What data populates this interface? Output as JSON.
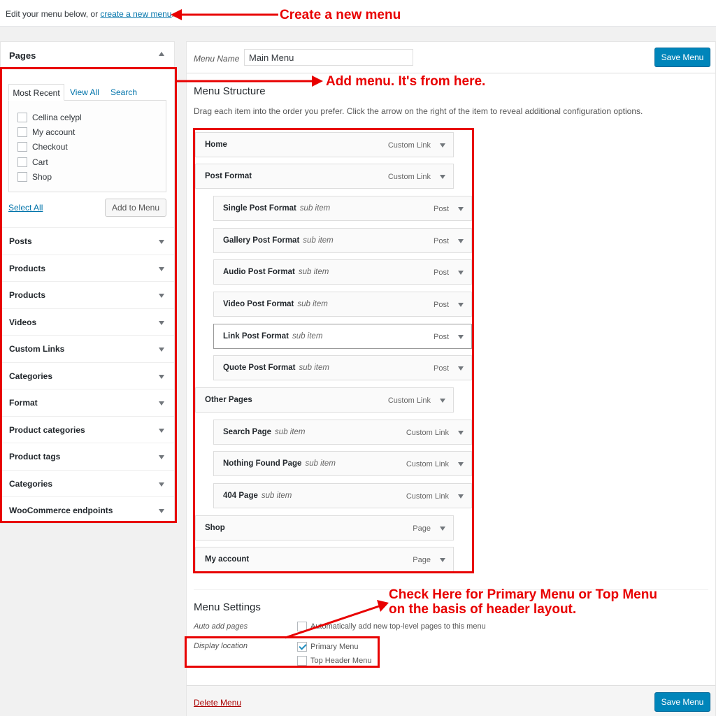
{
  "topbar": {
    "intro_text": "Edit your menu below, or",
    "create_link": "create a new menu",
    "trailing": "."
  },
  "left_panel": {
    "pages_title": "Pages",
    "tabs": [
      {
        "label": "Most Recent"
      },
      {
        "label": "View All"
      },
      {
        "label": "Search"
      }
    ],
    "pages": [
      {
        "label": "Cellina celypl"
      },
      {
        "label": "My account"
      },
      {
        "label": "Checkout"
      },
      {
        "label": "Cart"
      },
      {
        "label": "Shop"
      }
    ],
    "select_all": "Select All",
    "add_to_menu": "Add to Menu",
    "accordion": [
      {
        "label": "Posts"
      },
      {
        "label": "Products"
      },
      {
        "label": "Products"
      },
      {
        "label": "Videos"
      },
      {
        "label": "Custom Links"
      },
      {
        "label": "Categories"
      },
      {
        "label": "Format"
      },
      {
        "label": "Product categories"
      },
      {
        "label": "Product tags"
      },
      {
        "label": "Categories"
      },
      {
        "label": "WooCommerce endpoints"
      }
    ]
  },
  "menu": {
    "name_label": "Menu Name",
    "name_value": "Main Menu",
    "save_label": "Save Menu",
    "structure_title": "Menu Structure",
    "structure_desc": "Drag each item into the order you prefer. Click the arrow on the right of the item to reveal additional configuration options.",
    "items": [
      {
        "title": "Home",
        "sub": "",
        "type": "Custom Link"
      },
      {
        "title": "Post Format",
        "sub": "",
        "type": "Custom Link"
      },
      {
        "title": "Single Post Format",
        "sub": "sub item",
        "type": "Post"
      },
      {
        "title": "Gallery Post Format",
        "sub": "sub item",
        "type": "Post"
      },
      {
        "title": "Audio Post Format",
        "sub": "sub item",
        "type": "Post"
      },
      {
        "title": "Video Post Format",
        "sub": "sub item",
        "type": "Post"
      },
      {
        "title": "Link Post Format",
        "sub": "sub item",
        "type": "Post"
      },
      {
        "title": "Quote Post Format",
        "sub": "sub item",
        "type": "Post"
      },
      {
        "title": "Other Pages",
        "sub": "",
        "type": "Custom Link"
      },
      {
        "title": "Search Page",
        "sub": "sub item",
        "type": "Custom Link"
      },
      {
        "title": "Nothing Found Page",
        "sub": "sub item",
        "type": "Custom Link"
      },
      {
        "title": "404 Page",
        "sub": "sub item",
        "type": "Custom Link"
      },
      {
        "title": "Shop",
        "sub": "",
        "type": "Page"
      },
      {
        "title": "My account",
        "sub": "",
        "type": "Page"
      }
    ],
    "settings_title": "Menu Settings",
    "auto_add_label": "Auto add pages",
    "auto_add_text": "Automatically add new top-level pages to this menu",
    "display_location_label": "Display location",
    "locations": [
      {
        "label": "Primary Menu",
        "checked": true
      },
      {
        "label": "Top Header Menu",
        "checked": false
      }
    ],
    "delete_label": "Delete Menu"
  },
  "annotations": {
    "create_note": "Create a new menu",
    "add_note": "Add menu. It's from here.",
    "check_note_line1": "Check Here for Primary Menu or Top Menu",
    "check_note_line2": "on the basis of header layout.",
    "color": "#e80000"
  }
}
